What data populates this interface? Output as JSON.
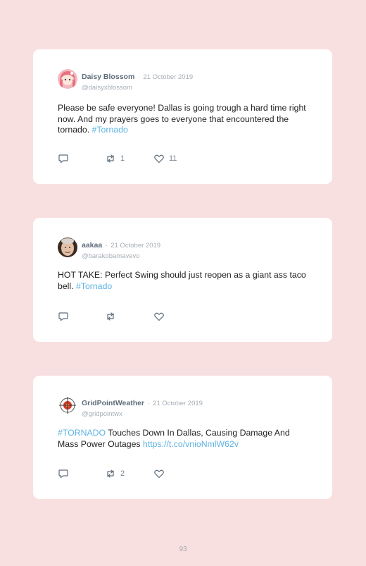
{
  "tweets": [
    {
      "name": "Daisy Blossom",
      "separator": "·",
      "date": "21 October 2019",
      "handle": "@daisyxblossom",
      "text_before": "Please be safe everyone! Dallas is going trough a hard time right now. And my prayers goes to everyone that encountered the tornado. ",
      "hashtag": "#Tornado",
      "text_after": "",
      "link": "",
      "retweets": "1",
      "likes": "11",
      "avatar": "anime-girl-avatar"
    },
    {
      "name": "aakaa",
      "separator": "·",
      "date": "21 October 2019",
      "handle": "@barakobamavevo",
      "text_before": "HOT TAKE: Perfect Swing should just reopen as a giant ass taco bell. ",
      "hashtag": "#Tornado",
      "text_after": "",
      "link": "",
      "retweets": "",
      "likes": "",
      "avatar": "photo-avatar"
    },
    {
      "name": "GridPointWeather",
      "separator": "·",
      "date": "21 October 2019",
      "handle": "@gridpointwx",
      "text_before": "",
      "hashtag": "#TORNADO",
      "text_after": " Touches Down In Dallas, Causing Damage And Mass Power Outages ",
      "link": "https://t.co/vnioNmlW62v",
      "retweets": "2",
      "likes": "",
      "avatar": "crosshair-logo-avatar"
    }
  ],
  "page_number": "93",
  "colors": {
    "background": "#f9e0e0",
    "card": "#ffffff",
    "hashtag": "#5db3e3",
    "name": "#5d6c7a",
    "muted": "#a6aeb6"
  }
}
